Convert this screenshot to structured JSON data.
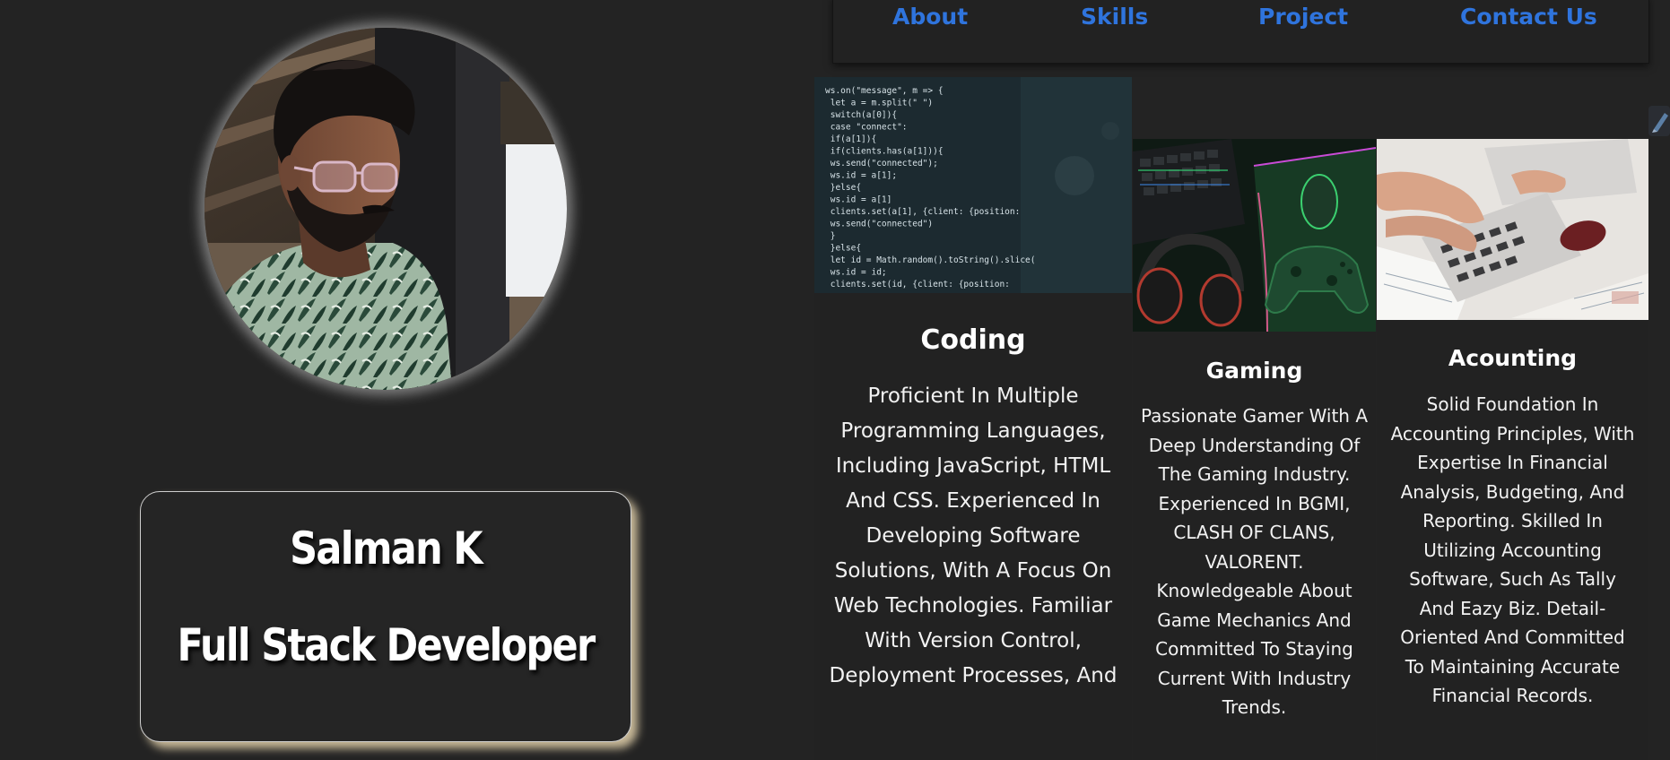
{
  "nav": {
    "links": [
      {
        "label": "About"
      },
      {
        "label": "Skills"
      },
      {
        "label": "Project"
      },
      {
        "label": "Contact Us"
      }
    ]
  },
  "profile": {
    "name": "Salman K",
    "title": "Full Stack Developer"
  },
  "skills": [
    {
      "title": "Coding",
      "description": "Proficient In Multiple Programming Languages, Including JavaScript, HTML And CSS. Experienced In Developing Software Solutions, With A Focus On Web Technologies. Familiar With Version Control, Deployment Processes, And",
      "code_lines": [
        "ws.on(\"message\", m => {",
        "  let a = m.split(\" \")",
        "  switch(a[0]){",
        "    case \"connect\":",
        "      if(a[1]){",
        "        if(clients.has(a[1])){",
        "          ws.send(\"connected\");",
        "          ws.id = a[1];",
        "        }else{",
        "          ws.id = a[1]",
        "          clients.set(a[1], {client: {position:",
        "          ws.send(\"connected\")",
        "        }",
        "      }else{",
        "        let id = Math.random().toString().slice(",
        "        ws.id = id;",
        "        clients.set(id, {client: {position:"
      ]
    },
    {
      "title": "Gaming",
      "description": "Passionate Gamer With A Deep Understanding Of The Gaming Industry. Experienced In BGMI, CLASH OF CLANS, VALORENT. Knowledgeable About Game Mechanics And Committed To Staying Current With Industry Trends."
    },
    {
      "title": "Acounting",
      "description": "Solid Foundation In Accounting Principles, With Expertise In Financial Analysis, Budgeting, And Reporting. Skilled In Utilizing Accounting Software, Such As Tally And Eazy Biz. Detail-Oriented And Committed To Maintaining Accurate Financial Records."
    }
  ],
  "colors": {
    "background": "#232323",
    "nav_link": "#2f74dd",
    "card_shadow": "#e8d6af",
    "text": "#ffffff"
  },
  "icons": {
    "edge_widget": "pencil-icon"
  }
}
